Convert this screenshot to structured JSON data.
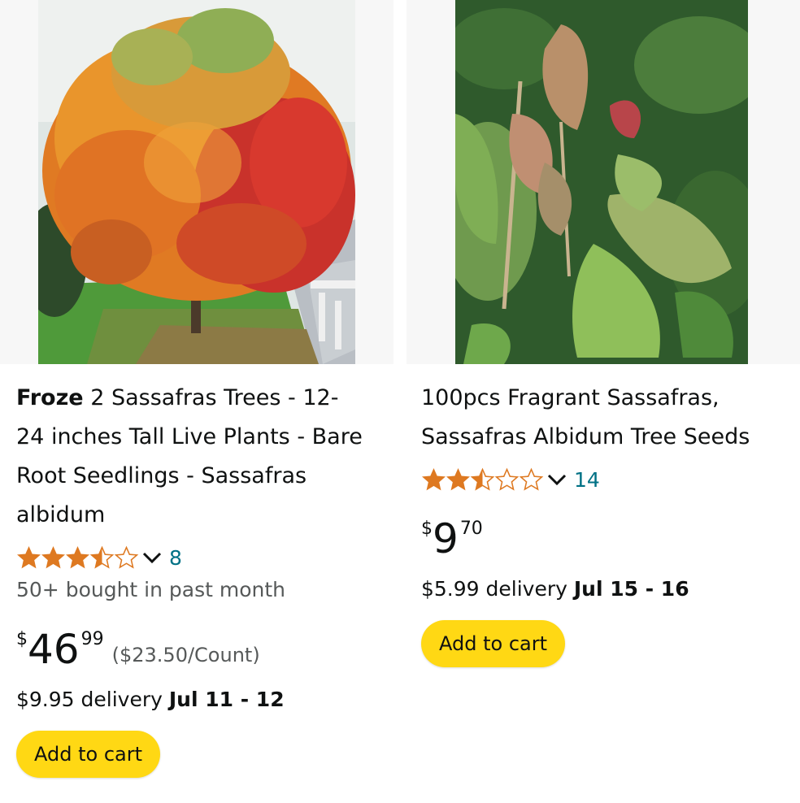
{
  "products": [
    {
      "brand": "Froze",
      "title": " 2 Sassafras Trees - 12-24 inches Tall Live Plants - Bare Root Seedlings - Sassafras albidum",
      "rating_count": "8",
      "rating_stars": 3.5,
      "bought": "50+ bought in past month",
      "price_symbol": "$",
      "price_whole": "46",
      "price_fraction": "99",
      "unit_price": "($23.50/Count)",
      "delivery_prefix": "$9.95 delivery ",
      "delivery_date": "Jul 11 - 12",
      "cart_label": "Add to cart",
      "image_icon": "autumn-tree-photo"
    },
    {
      "title": "100pcs Fragrant Sassafras, Sassafras Albidum Tree Seeds",
      "rating_count": "14",
      "rating_stars": 2.5,
      "price_symbol": "$",
      "price_whole": "9",
      "price_fraction": "70",
      "delivery_prefix": "$5.99 delivery ",
      "delivery_date": "Jul 15 - 16",
      "cart_label": "Add to cart",
      "image_icon": "sassafras-leaves-photo"
    }
  ],
  "colors": {
    "star": "#de7921",
    "link": "#007185",
    "button": "#ffd814",
    "muted": "#565959"
  }
}
